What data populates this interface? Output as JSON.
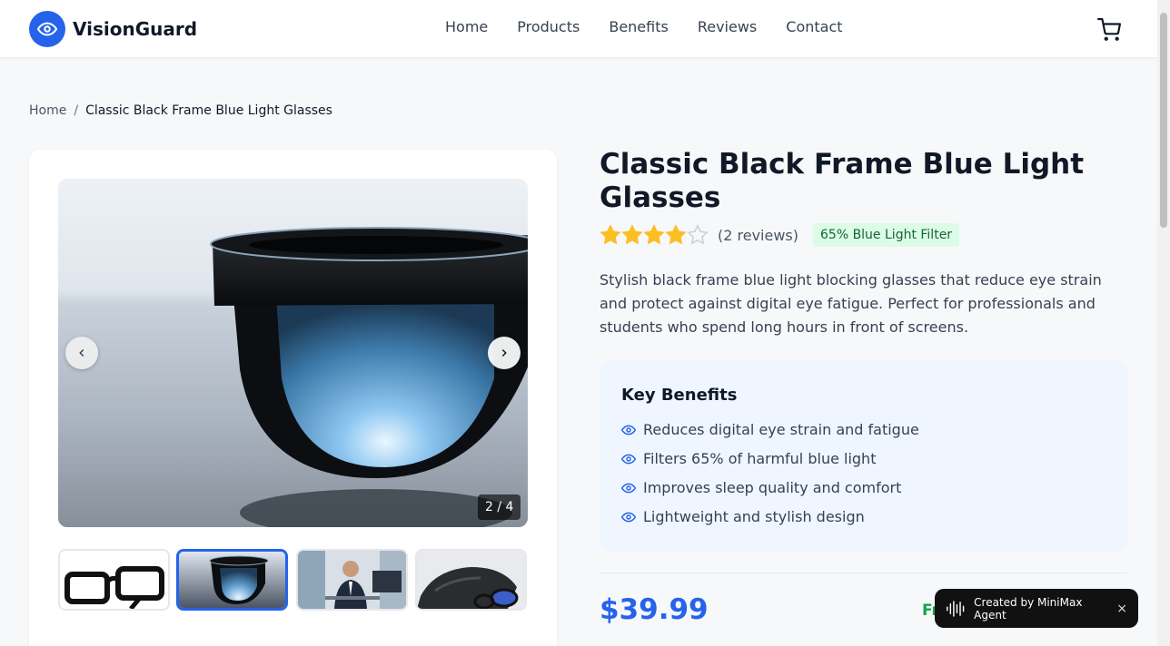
{
  "header": {
    "brand": "VisionGuard",
    "nav": [
      "Home",
      "Products",
      "Benefits",
      "Reviews",
      "Contact"
    ]
  },
  "breadcrumb": {
    "home": "Home",
    "separator": "/",
    "current": "Classic Black Frame Blue Light Glasses"
  },
  "gallery": {
    "counter": "2 / 4",
    "active_index": 2,
    "total": 4,
    "thumbnails": [
      "black-frame-glasses",
      "blue-lens-closeup",
      "man-at-computer",
      "glasses-with-pouch"
    ]
  },
  "product": {
    "title": "Classic Black Frame Blue Light Glasses",
    "rating": 4,
    "rating_max": 5,
    "reviews": "(2 reviews)",
    "badge": "65% Blue Light Filter",
    "description": "Stylish black frame blue light blocking glasses that reduce eye strain and protect against digital eye fatigue. Perfect for professionals and students who spend long hours in front of screens.",
    "benefits_title": "Key Benefits",
    "benefits": [
      "Reduces digital eye strain and fatigue",
      "Filters 65% of harmful blue light",
      "Improves sleep quality and comfort",
      "Lightweight and stylish design"
    ],
    "price": "$39.99",
    "shipping_peek": "Fr"
  },
  "toast": {
    "text": "Created by MiniMax Agent",
    "close": "×"
  },
  "colors": {
    "accent": "#2563eb",
    "star": "#fbbf24",
    "badge_bg": "#dcfce7",
    "badge_text": "#166534",
    "benefits_bg": "#eff6ff"
  }
}
